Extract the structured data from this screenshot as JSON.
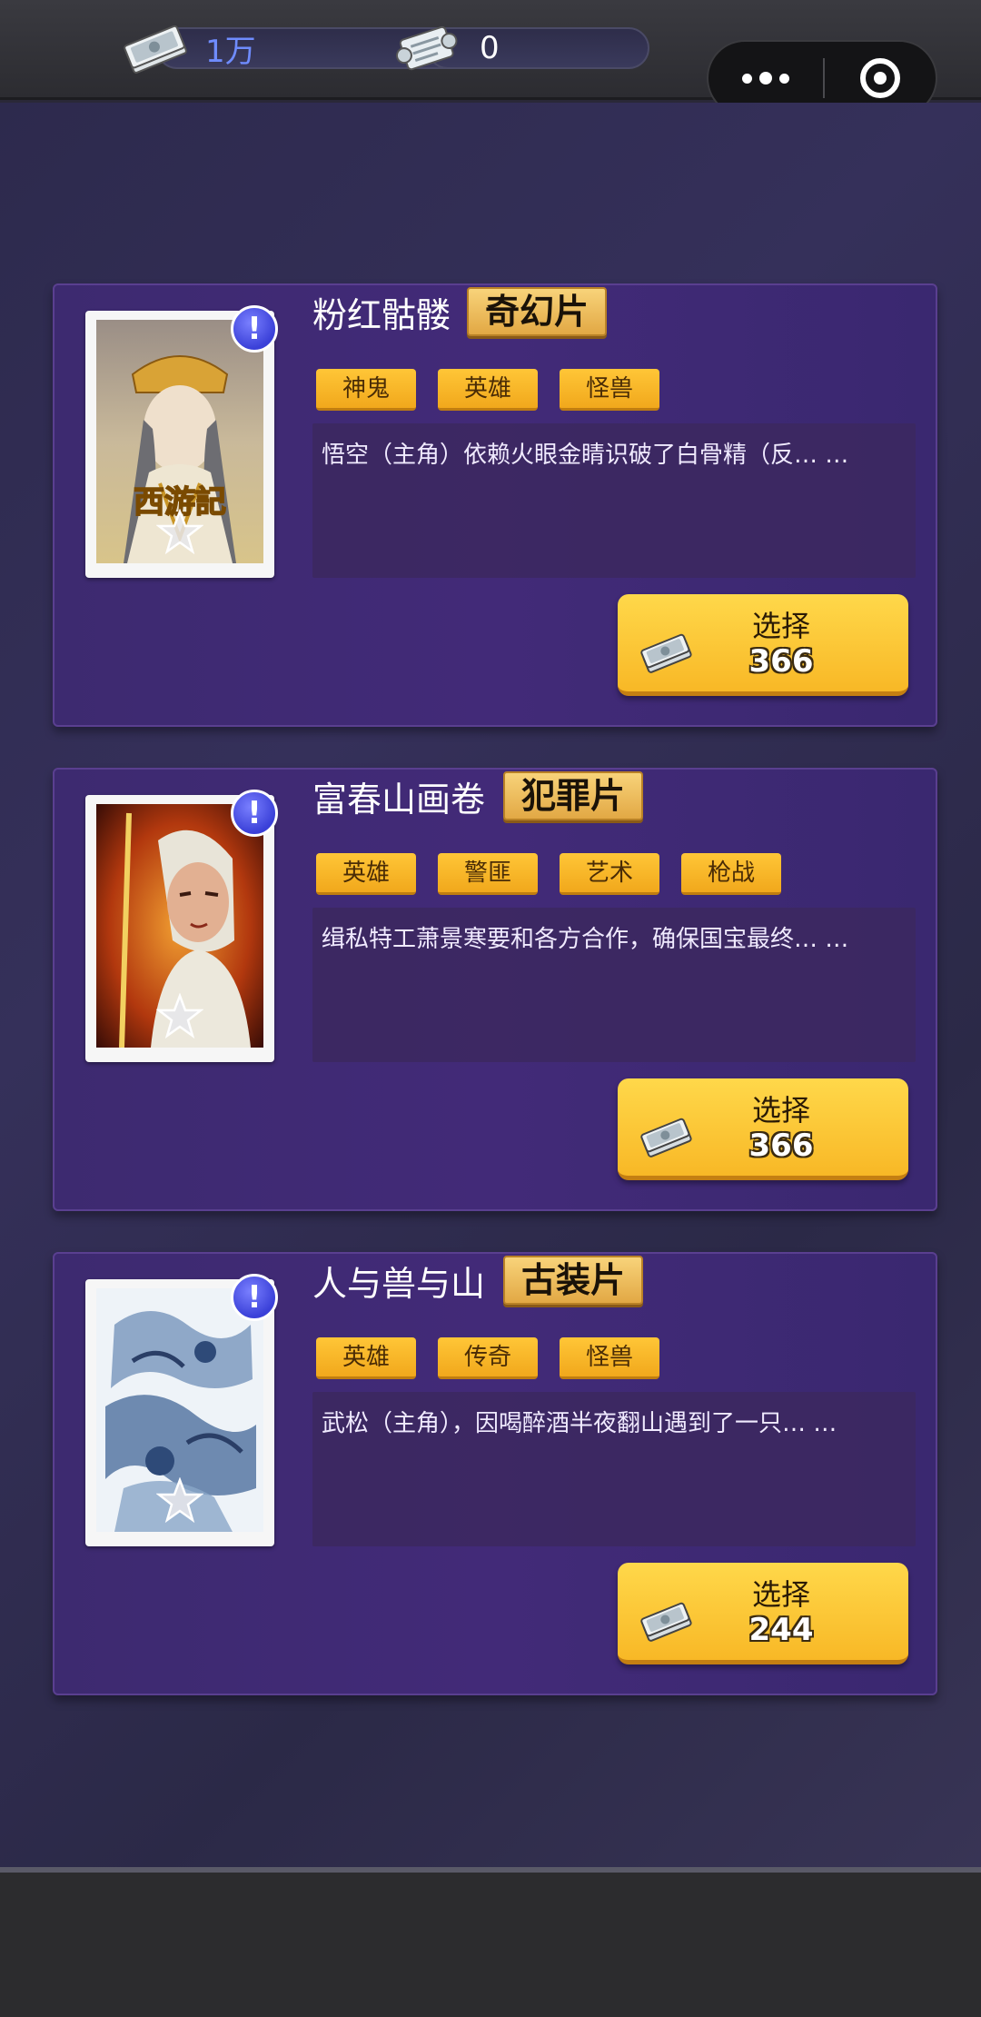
{
  "topbar": {
    "currency_1": {
      "icon": "money-stack-icon",
      "value": "1万",
      "color": "#6f8cff"
    },
    "currency_2": {
      "icon": "scroll-ticket-icon",
      "value": "0"
    },
    "capsule": {
      "more_icon": "more-dots-icon",
      "close_icon": "target-circle-icon"
    }
  },
  "movies": [
    {
      "title": "粉红骷髅",
      "genre": "奇幻片",
      "tags": [
        "神鬼",
        "英雄",
        "怪兽"
      ],
      "description": "悟空（主角）依赖火眼金睛识破了白骨精（反… …",
      "button_label": "选择",
      "price": "366",
      "badge": "!",
      "poster_icon": "monk-poster-image"
    },
    {
      "title": "富春山画卷",
      "genre": "犯罪片",
      "tags": [
        "英雄",
        "警匪",
        "艺术",
        "枪战"
      ],
      "description": "缉私特工萧景寒要和各方合作，确保国宝最终… …",
      "button_label": "选择",
      "price": "366",
      "badge": "!",
      "poster_icon": "swordsman-poster-image"
    },
    {
      "title": "人与兽与山",
      "genre": "古装片",
      "tags": [
        "英雄",
        "传奇",
        "怪兽"
      ],
      "description": "武松（主角），因喝醉酒半夜翻山遇到了一只… …",
      "button_label": "选择",
      "price": "244",
      "badge": "!",
      "poster_icon": "tiger-ink-poster-image"
    }
  ],
  "colors": {
    "card_bg": "#422a78",
    "tag_yellow": "#ffc637",
    "button_yellow": "#ffd84a",
    "badge_blue": "#3a40d8"
  }
}
